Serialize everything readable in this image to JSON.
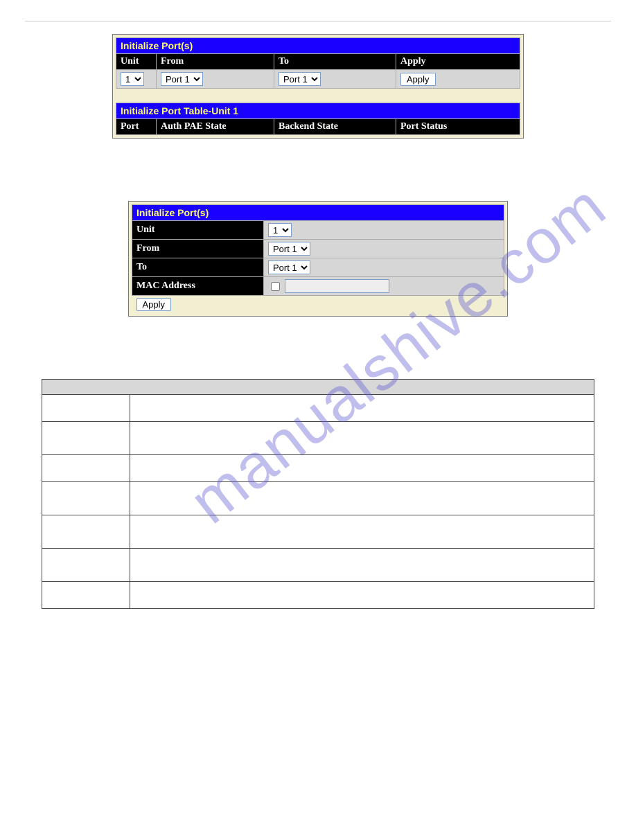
{
  "watermark": "manualshive.com",
  "panel1": {
    "title": "Initialize Port(s)",
    "cols": {
      "unit": "Unit",
      "from": "From",
      "to": "To",
      "apply": "Apply"
    },
    "unit_value": "1",
    "from_value": "Port 1",
    "to_value": "Port 1",
    "apply_btn": "Apply",
    "table2_title": "Initialize Port Table-Unit 1",
    "cols2": {
      "port": "Port",
      "auth": "Auth PAE State",
      "backend": "Backend State",
      "status": "Port Status"
    }
  },
  "panel2": {
    "title": "Initialize Port(s)",
    "rows": {
      "unit": "Unit",
      "from": "From",
      "to": "To",
      "mac": "MAC Address"
    },
    "unit_value": "1",
    "from_value": "Port 1",
    "to_value": "Port 1",
    "mac_value": "",
    "apply_btn": "Apply"
  }
}
